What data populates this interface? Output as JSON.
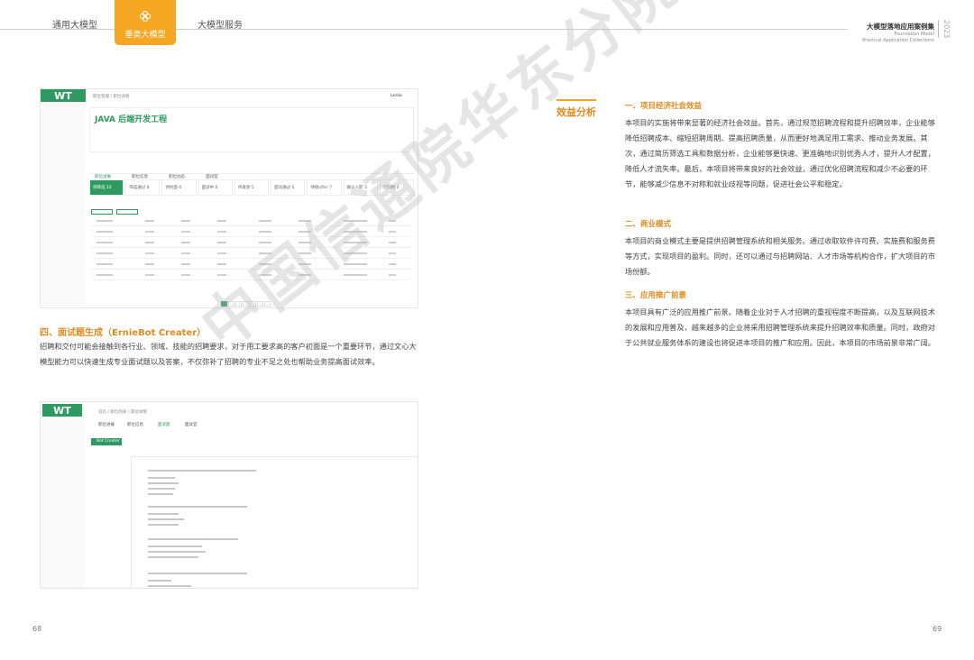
{
  "header": {
    "tabs": [
      {
        "label": "通用大模型"
      },
      {
        "label": "垂类大模型"
      },
      {
        "label": "大模型服务"
      }
    ],
    "publication": {
      "title": "大模型落地应用案例集",
      "sub1": "Foundation Model",
      "sub2": "Practical Application Collections",
      "year": "2023"
    }
  },
  "left": {
    "screenshot1": {
      "logo": "WT",
      "breadcrumb": "职位管理 / 职位详情",
      "user": "Leslie",
      "job_title": "JAVA 后端开发工程",
      "tabs": [
        "职位进展",
        "职位信息",
        "职位动态",
        "面试官"
      ],
      "stages": [
        "待筛选 10",
        "筛选通过 8",
        "待约面 0",
        "面试中 6",
        "待发放 5",
        "面试通过 6",
        "待接offer 7",
        "确认入职 3",
        "已归档 3"
      ],
      "pages": [
        "1",
        "2",
        "3",
        "4",
        "5",
        "...",
        "10"
      ]
    },
    "section_title": "四、面试题生成（ErnieBot Creater）",
    "section_text": "招聘和交付可能会接触到各行业、领域、技能的招聘要求，对于用工要求高的客户初面是一个重要环节，通过文心大模型能力可以快速生成专业面试题以及答案，不仅弥补了招聘的专业不足之处也帮助业务提高面试效率。",
    "screenshot2": {
      "logo": "WT",
      "breadcrumb": "首页 / 职位列表 / 职位详情",
      "tabs": [
        "职位进展",
        "职位信息",
        "面试题",
        "面试官"
      ],
      "button": "Bot Creater"
    }
  },
  "right": {
    "side_label": "效益分析",
    "sections": [
      {
        "title": "一、项目经济社会效益",
        "text": "本项目的实施将带来显著的经济社会效益。首先，通过规范招聘流程和提升招聘效率，企业能够降低招聘成本、缩短招聘周期、提高招聘质量，从而更好地满足用工需求、推动业务发展。其次，通过简历筛选工具和数据分析，企业能够更快速、更准确地识别优秀人才，提升人才配置，降低人才流失率。最后，本项目将带来良好的社会效益，通过优化招聘流程和减少不必要的环节，能够减少信息不对称和就业歧视等问题，促进社会公平和稳定。"
      },
      {
        "title": "二、商业模式",
        "text": "本项目的商业模式主要是提供招聘管理系统和相关服务。通过收取软件许可费、实施费和服务费等方式，实现项目的盈利。同时，还可以通过与招聘网站、人才市场等机构合作，扩大项目的市场份额。"
      },
      {
        "title": "三、应用推广前景",
        "text": "本项目具有广泛的应用推广前景。随着企业对于人才招聘的重视程度不断提高，以及互联网技术的发展和应用普及，越来越多的企业将采用招聘管理系统来提升招聘效率和质量。同时，政府对于公共就业服务体系的建设也将促进本项目的推广和应用。因此，本项目的市场前景非常广阔。"
      }
    ]
  },
  "watermark": "中国信通院华东分院",
  "page_numbers": {
    "left": "68",
    "right": "69"
  },
  "colors": {
    "accent": "#f5a623",
    "heading": "#e08a1e",
    "brand_green": "#2e9a62"
  }
}
